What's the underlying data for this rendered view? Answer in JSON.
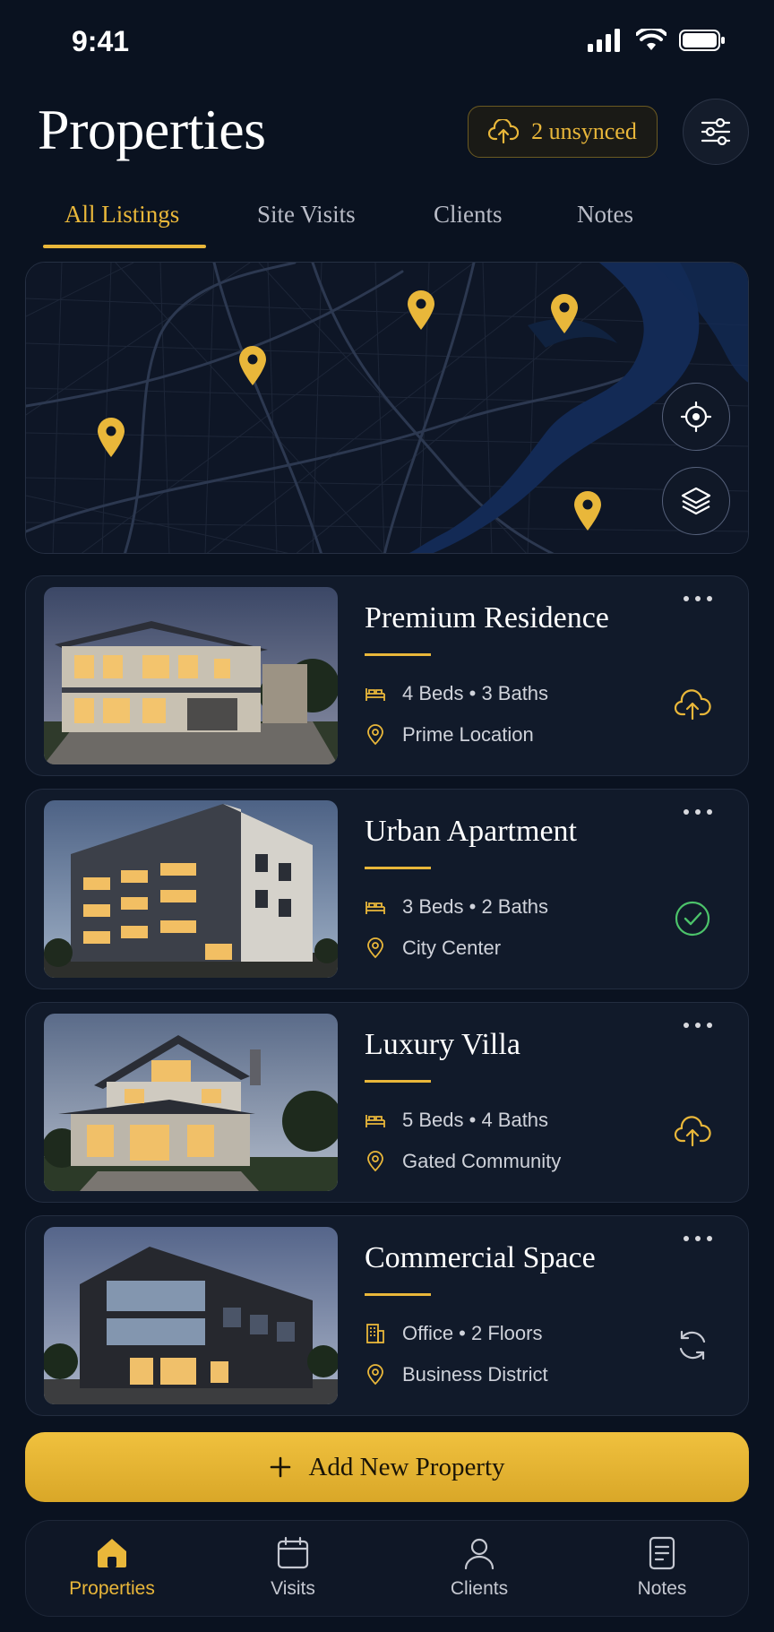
{
  "status_bar": {
    "time": "9:41"
  },
  "header": {
    "title": "Properties",
    "sync_label": "2 unsynced"
  },
  "tabs": [
    {
      "label": "All Listings",
      "active": true
    },
    {
      "label": "Site Visits",
      "active": false
    },
    {
      "label": "Clients",
      "active": false
    },
    {
      "label": "Notes",
      "active": false
    }
  ],
  "map": {
    "icons": [
      "locate-icon",
      "layers-icon"
    ],
    "pin_count": 5
  },
  "listings": [
    {
      "title": "Premium Residence",
      "spec": "4 Beds",
      "spec2": "3 Baths",
      "spec_icon": "bed-icon",
      "location": "Prime Location",
      "sync_status": "pending-upload"
    },
    {
      "title": "Urban Apartment",
      "spec": "3 Beds",
      "spec2": "2 Baths",
      "spec_icon": "bed-icon",
      "location": "City Center",
      "sync_status": "synced"
    },
    {
      "title": "Luxury Villa",
      "spec": "5 Beds",
      "spec2": "4 Baths",
      "spec_icon": "bed-icon",
      "location": "Gated Community",
      "sync_status": "pending-upload"
    },
    {
      "title": "Commercial Space",
      "spec": "Office",
      "spec2": "2 Floors",
      "spec_icon": "building-icon",
      "location": "Business District",
      "sync_status": "syncing"
    }
  ],
  "add_button": {
    "label": "Add New Property"
  },
  "bottom_nav": [
    {
      "label": "Properties",
      "active": true
    },
    {
      "label": "Visits",
      "active": false
    },
    {
      "label": "Clients",
      "active": false
    },
    {
      "label": "Notes",
      "active": false
    }
  ],
  "colors": {
    "accent": "#e9b73a",
    "background": "#0a1220",
    "card": "#111a2a",
    "success": "#4cc36a"
  }
}
